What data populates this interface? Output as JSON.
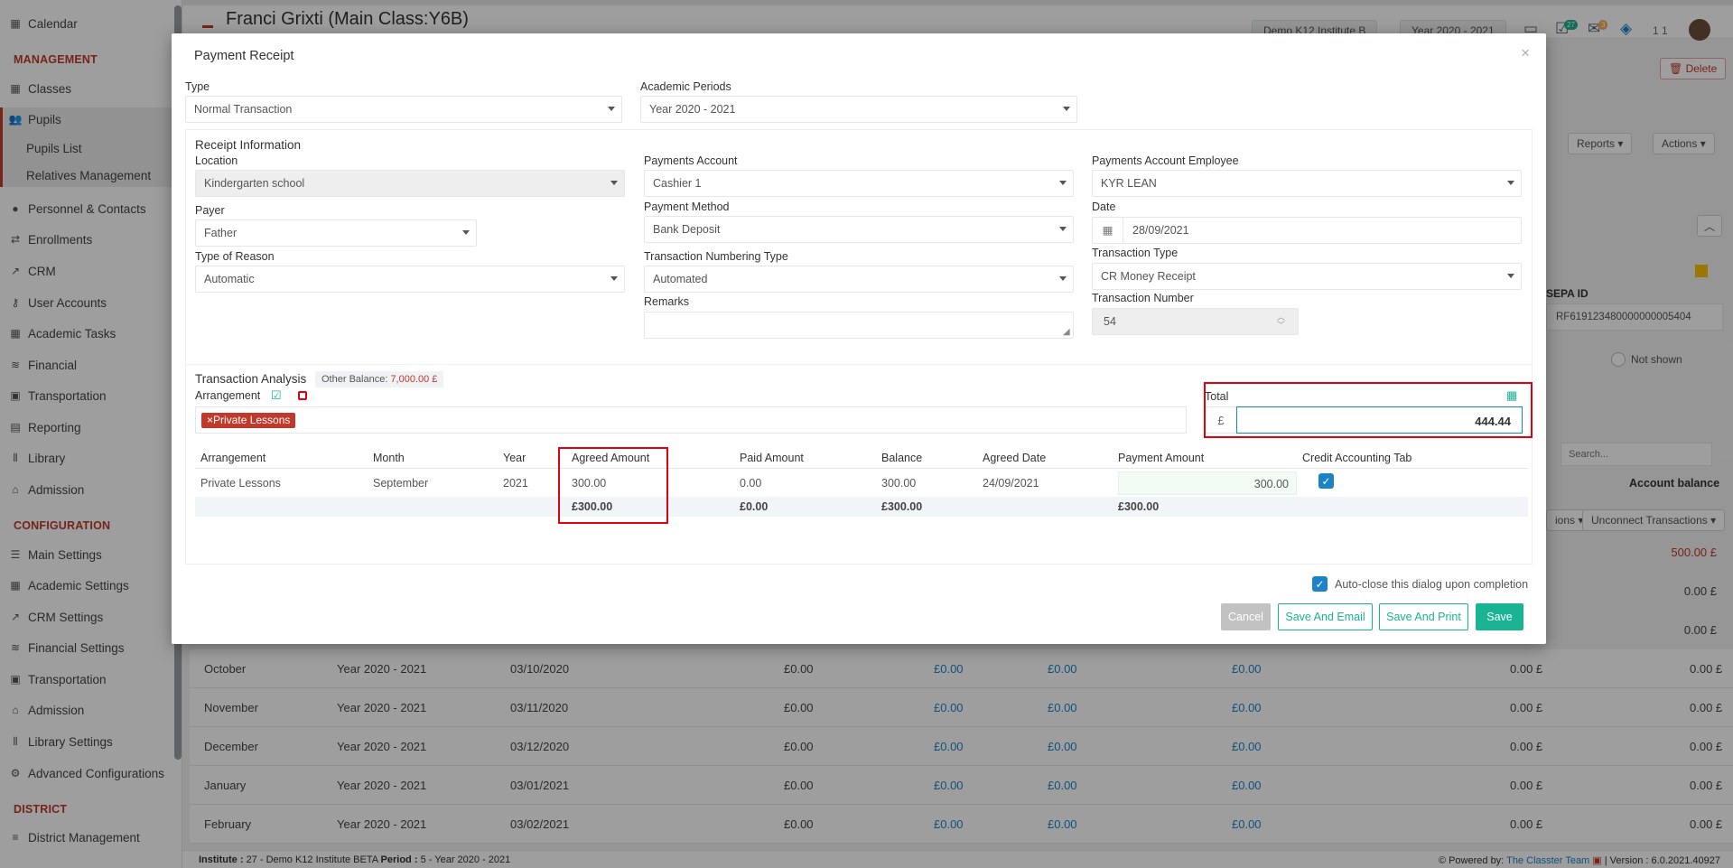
{
  "app": {
    "page_title": "Franci Grixti (Main Class:Y6B)",
    "institute_pill": "Demo K12 Institute B",
    "year_pill": "Year 2020 - 2021",
    "badge_tasks": "27",
    "badge_mail": "3",
    "user_counter": "1 1"
  },
  "sidebar": {
    "calendar": "Calendar",
    "section_management": "MANAGEMENT",
    "classes": "Classes",
    "pupils": "Pupils",
    "pupils_list": "Pupils List",
    "relatives": "Relatives Management",
    "personnel": "Personnel & Contacts",
    "enrollments": "Enrollments",
    "crm": "CRM",
    "user_accounts": "User Accounts",
    "academic_tasks": "Academic Tasks",
    "financial": "Financial",
    "transportation": "Transportation",
    "reporting": "Reporting",
    "library": "Library",
    "admission": "Admission",
    "section_configuration": "CONFIGURATION",
    "main_settings": "Main Settings",
    "academic_settings": "Academic Settings",
    "crm_settings": "CRM Settings",
    "financial_settings": "Financial Settings",
    "transportation_cfg": "Transportation",
    "admission_cfg": "Admission",
    "library_settings": "Library Settings",
    "advanced_config": "Advanced Configurations",
    "section_district": "DISTRICT",
    "district_management": "District Management"
  },
  "background": {
    "delete_btn": "Delete",
    "reports_btn": "Reports",
    "actions_btn": "Actions",
    "sepa_label": "SEPA ID",
    "sepa_value": "RF619123480000000005404",
    "not_shown": "Not shown",
    "search_placeholder": "Search...",
    "account_balance": "Account balance",
    "ions_btn": "ions",
    "unconnect_btn": "Unconnect Transactions",
    "first_balance": "500.00 £",
    "rows": [
      {
        "month": "October",
        "period": "Year 2020 - 2021",
        "date": "03/10/2020",
        "a": "£0.00",
        "b": "£0.00",
        "c": "£0.00",
        "d": "£0.00",
        "e": "0.00 £",
        "f": "0.00 £"
      },
      {
        "month": "November",
        "period": "Year 2020 - 2021",
        "date": "03/11/2020",
        "a": "£0.00",
        "b": "£0.00",
        "c": "£0.00",
        "d": "£0.00",
        "e": "0.00 £",
        "f": "0.00 £"
      },
      {
        "month": "December",
        "period": "Year 2020 - 2021",
        "date": "03/12/2020",
        "a": "£0.00",
        "b": "£0.00",
        "c": "£0.00",
        "d": "£0.00",
        "e": "0.00 £",
        "f": "0.00 £"
      },
      {
        "month": "January",
        "period": "Year 2020 - 2021",
        "date": "03/01/2021",
        "a": "£0.00",
        "b": "£0.00",
        "c": "£0.00",
        "d": "£0.00",
        "e": "0.00 £",
        "f": "0.00 £"
      },
      {
        "month": "February",
        "period": "Year 2020 - 2021",
        "date": "03/02/2021",
        "a": "£0.00",
        "b": "£0.00",
        "c": "£0.00",
        "d": "£0.00",
        "e": "0.00 £",
        "f": "0.00 £"
      }
    ],
    "right_zeros": [
      "0.00 £",
      "0.00 £"
    ]
  },
  "footer": {
    "institute_label": "Institute :",
    "institute_value": "27 - Demo K12 Institute BETA",
    "period_label": "Period :",
    "period_value": "5 - Year 2020 - 2021",
    "powered_by": "Powered by:",
    "team": "The Classter Team",
    "version": "| Version : 6.0.2021.40927"
  },
  "modal": {
    "title": "Payment Receipt",
    "type_label": "Type",
    "type_value": "Normal Transaction",
    "academic_periods_label": "Academic Periods",
    "academic_periods_value": "Year 2020 - 2021",
    "receipt_info_title": "Receipt Information",
    "location_label": "Location",
    "location_value": "Kindergarten school",
    "payer_label": "Payer",
    "payer_value": "Father",
    "type_of_reason_label": "Type of Reason",
    "type_of_reason_value": "Automatic",
    "payments_account_label": "Payments Account",
    "payments_account_value": "Cashier 1",
    "payment_method_label": "Payment Method",
    "payment_method_value": "Bank Deposit",
    "numbering_type_label": "Transaction Numbering Type",
    "numbering_type_value": "Automated",
    "remarks_label": "Remarks",
    "remarks_value": "",
    "account_employee_label": "Payments Account Employee",
    "account_employee_value": "KYR LEAN",
    "date_label": "Date",
    "date_value": "28/09/2021",
    "transaction_type_label": "Transaction Type",
    "transaction_type_value": "CR Money Receipt",
    "transaction_number_label": "Transaction Number",
    "transaction_number_value": "54",
    "analysis_title": "Transaction Analysis",
    "other_balance_label": "Other Balance:",
    "other_balance_value": "7,000.00 £",
    "arrangement_label": "Arrangement",
    "arrangement_tag": "Private Lessons",
    "total_label": "Total",
    "currency": "£",
    "total_value": "444.44",
    "columns": [
      "Arrangement",
      "Month",
      "Year",
      "Agreed Amount",
      "Paid Amount",
      "Balance",
      "Agreed Date",
      "Payment Amount",
      "Credit Accounting Tab"
    ],
    "row": {
      "arrangement": "Private Lessons",
      "month": "September",
      "year": "2021",
      "agreed": "300.00",
      "paid": "0.00",
      "balance": "300.00",
      "agreed_date": "24/09/2021",
      "payment": "300.00"
    },
    "totals": {
      "agreed": "£300.00",
      "paid": "£0.00",
      "balance": "£300.00",
      "payment": "£300.00"
    },
    "auto_close": "Auto-close this dialog upon completion",
    "cancel": "Cancel",
    "save_email": "Save And Email",
    "save_print": "Save And Print",
    "save": "Save"
  },
  "colors": {
    "accent": "#1ab394",
    "brand_red": "#c0392b",
    "highlight_box": "#e3000f",
    "link_blue": "#1c84c6"
  }
}
